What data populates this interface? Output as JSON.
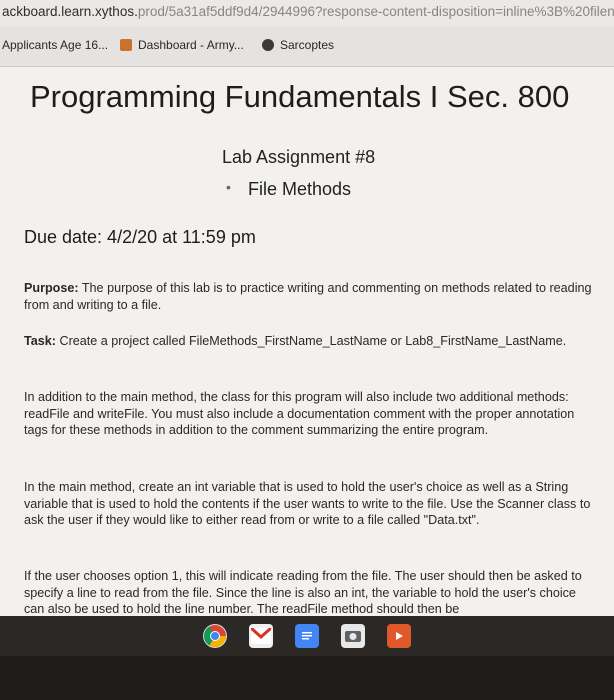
{
  "browser": {
    "url_host": "ackboard.learn.xythos.",
    "url_path": "prod/5a31af5ddf9d4/2944996?response-content-disposition=inline%3B%20filenam",
    "bookmarks": [
      {
        "label": "Applicants Age 16..."
      },
      {
        "label": "Dashboard - Army..."
      },
      {
        "label": "Sarcoptes"
      }
    ]
  },
  "document": {
    "title": "Programming Fundamentals I Sec. 800",
    "subtitle": "Lab Assignment #8",
    "subtitle2": "File Methods",
    "bullet": "•",
    "due": "Due date: 4/2/20 at 11:59 pm",
    "purpose_label": "Purpose:",
    "purpose_text": " The purpose of this lab is to practice writing and commenting on methods related to reading from and writing to a file.",
    "task_label": "Task:",
    "task_text": " Create a project called FileMethods_FirstName_LastName or Lab8_FirstName_LastName.",
    "p3": "In addition to the main method, the class for this program will also include two additional methods: readFile and writeFile. You must also include a documentation comment with the proper annotation tags for these methods in addition to the comment summarizing the entire program.",
    "p4": "In the main method, create an int variable that is used to hold the user's choice as well as a String variable that is used to hold the contents if the user wants to write to the file. Use the Scanner class to ask the user if they would like to either read from or write to a file called \"Data.txt\".",
    "p5": "If the user chooses option 1, this will indicate reading from the file. The user should then be asked to specify a line to read from the file. Since the line is also an int, the variable to hold the user's choice can also be used to hold the line number. The readFile method should then be"
  },
  "shelf": {
    "apps": [
      {
        "name": "chrome-icon",
        "color": "#dcdcdc"
      },
      {
        "name": "gmail-icon",
        "color": "#e8e8e8"
      },
      {
        "name": "docs-icon",
        "color": "#4285f4"
      },
      {
        "name": "camera-icon",
        "color": "#e8e8e8"
      },
      {
        "name": "youtube-icon",
        "color": "#e0582a"
      }
    ]
  }
}
